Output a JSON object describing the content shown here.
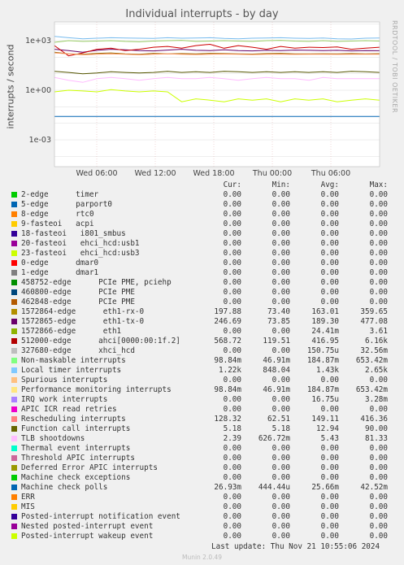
{
  "chart_data": {
    "type": "line",
    "title": "Individual interrupts - by day",
    "ylabel": "interrupts / second",
    "yscale": "log",
    "y_ticks": [
      "1e+03",
      "1e+00",
      "1e-03"
    ],
    "x_ticks": [
      "Wed 06:00",
      "Wed 12:00",
      "Wed 18:00",
      "Thu 00:00",
      "Thu 06:00"
    ],
    "grid": true,
    "series": [
      {
        "name": "Local timer interrupts",
        "color": "#77bbee",
        "values": [
          1800,
          1500,
          1300,
          1400,
          1500,
          1450,
          1400,
          1350,
          1500,
          1400,
          1450,
          1500,
          1350,
          1300,
          1400,
          1450,
          1500,
          1400,
          1350,
          1450,
          1300,
          1250,
          1400,
          1450
        ]
      },
      {
        "name": "Non-maskable interrupts",
        "color": "#99cc66",
        "values": [
          800,
          1000,
          900,
          950,
          1000,
          900,
          850,
          950,
          1000,
          1050,
          900,
          950,
          1000,
          950,
          900,
          1000,
          1050,
          950,
          900,
          1000,
          900,
          950,
          1000,
          950
        ]
      },
      {
        "name": "1572865-edge eth1-tx-0",
        "color": "#660066",
        "values": [
          300,
          250,
          200,
          260,
          300,
          280,
          250,
          240,
          270,
          300,
          260,
          250,
          280,
          250,
          240,
          260,
          250,
          270,
          260,
          250,
          260,
          240,
          250,
          245
        ]
      },
      {
        "name": "512000-edge ahci[0000:00:1f.2]",
        "color": "#cc0000",
        "values": [
          500,
          120,
          180,
          300,
          350,
          250,
          300,
          400,
          450,
          350,
          500,
          600,
          350,
          500,
          400,
          300,
          450,
          350,
          400,
          380,
          420,
          300,
          350,
          400
        ]
      },
      {
        "name": "1572864-edge eth1-rx-0",
        "color": "#996600",
        "values": [
          200,
          160,
          150,
          170,
          180,
          160,
          150,
          170,
          160,
          165,
          160,
          170,
          165,
          160,
          155,
          165,
          170,
          160,
          158,
          162,
          160,
          165,
          160,
          163
        ]
      },
      {
        "name": "Rescheduling interrupts",
        "color": "#ff9966",
        "values": [
          180,
          160,
          140,
          150,
          160,
          150,
          140,
          150,
          160,
          150,
          145,
          150,
          155,
          150,
          145,
          150,
          150,
          148,
          150,
          150,
          148,
          150,
          149,
          149
        ]
      },
      {
        "name": "Function call interrupts",
        "color": "#555500",
        "values": [
          14,
          12,
          10,
          11,
          13,
          12,
          11,
          12,
          14,
          12,
          13,
          12,
          14,
          13,
          12,
          13,
          12,
          13,
          12,
          13,
          12,
          14,
          13,
          12
        ]
      },
      {
        "name": "TLB shootdowns",
        "color": "#ffbbff",
        "values": [
          6,
          4,
          3,
          5,
          6,
          5,
          4,
          5,
          6,
          5,
          5,
          6,
          5,
          4,
          5,
          6,
          5,
          5,
          4,
          6,
          5,
          5,
          5,
          5
        ]
      },
      {
        "name": "Machine check polls",
        "color": "#0066b3",
        "values": [
          0.026,
          0.026,
          0.026,
          0.026,
          0.026,
          0.026,
          0.026,
          0.026,
          0.026,
          0.026,
          0.026,
          0.026,
          0.026,
          0.026,
          0.026,
          0.026,
          0.026,
          0.026,
          0.026,
          0.026,
          0.026,
          0.026,
          0.026,
          0.026
        ]
      },
      {
        "name": "23-fasteoi ehci_hcd:usb3",
        "color": "#ccff00",
        "values": [
          0.8,
          1.0,
          0.9,
          0.8,
          1.1,
          0.9,
          0.8,
          0.9,
          0.8,
          0.2,
          0.3,
          0.25,
          0.2,
          0.3,
          0.25,
          0.3,
          0.2,
          0.3,
          0.25,
          0.3,
          0.2,
          0.25,
          0.3,
          0.25
        ]
      }
    ]
  },
  "legend": {
    "headers": {
      "cur": "Cur:",
      "min": "Min:",
      "avg": "Avg:",
      "max": "Max:"
    },
    "rows": [
      {
        "color": "#00cc00",
        "label": "2-edge      timer",
        "cur": "0.00",
        "min": "0.00",
        "avg": "0.00",
        "max": "0.00"
      },
      {
        "color": "#0066b3",
        "label": "5-edge      parport0",
        "cur": "0.00",
        "min": "0.00",
        "avg": "0.00",
        "max": "0.00"
      },
      {
        "color": "#ff8000",
        "label": "8-edge      rtc0",
        "cur": "0.00",
        "min": "0.00",
        "avg": "0.00",
        "max": "0.00"
      },
      {
        "color": "#ffcc00",
        "label": "9-fasteoi   acpi",
        "cur": "0.00",
        "min": "0.00",
        "avg": "0.00",
        "max": "0.00"
      },
      {
        "color": "#330099",
        "label": "18-fasteoi   i801_smbus",
        "cur": "0.00",
        "min": "0.00",
        "avg": "0.00",
        "max": "0.00"
      },
      {
        "color": "#990099",
        "label": "20-fasteoi   ehci_hcd:usb1",
        "cur": "0.00",
        "min": "0.00",
        "avg": "0.00",
        "max": "0.00"
      },
      {
        "color": "#ccff00",
        "label": "23-fasteoi   ehci_hcd:usb3",
        "cur": "0.00",
        "min": "0.00",
        "avg": "0.00",
        "max": "0.00"
      },
      {
        "color": "#ff0000",
        "label": "0-edge      dmar0",
        "cur": "0.00",
        "min": "0.00",
        "avg": "0.00",
        "max": "0.00"
      },
      {
        "color": "#808080",
        "label": "1-edge      dmar1",
        "cur": "0.00",
        "min": "0.00",
        "avg": "0.00",
        "max": "0.00"
      },
      {
        "color": "#008f00",
        "label": "458752-edge      PCIe PME, pciehp",
        "cur": "0.00",
        "min": "0.00",
        "avg": "0.00",
        "max": "0.00"
      },
      {
        "color": "#00487d",
        "label": "460800-edge      PCIe PME",
        "cur": "0.00",
        "min": "0.00",
        "avg": "0.00",
        "max": "0.00"
      },
      {
        "color": "#b35a00",
        "label": "462848-edge      PCIe PME",
        "cur": "0.00",
        "min": "0.00",
        "avg": "0.00",
        "max": "0.00"
      },
      {
        "color": "#b38f00",
        "label": "1572864-edge      eth1-rx-0",
        "cur": "197.88",
        "min": "73.40",
        "avg": "163.01",
        "max": "359.65"
      },
      {
        "color": "#6b006b",
        "label": "1572865-edge      eth1-tx-0",
        "cur": "246.69",
        "min": "73.85",
        "avg": "189.30",
        "max": "477.08"
      },
      {
        "color": "#8fb300",
        "label": "1572866-edge      eth1",
        "cur": "0.00",
        "min": "0.00",
        "avg": "24.41m",
        "max": "3.61"
      },
      {
        "color": "#b30000",
        "label": "512000-edge      ahci[0000:00:1f.2]",
        "cur": "568.72",
        "min": "119.51",
        "avg": "416.95",
        "max": "6.16k"
      },
      {
        "color": "#bebebe",
        "label": "327680-edge      xhci_hcd",
        "cur": "0.00",
        "min": "0.00",
        "avg": "150.75u",
        "max": "32.56m"
      },
      {
        "color": "#80ff80",
        "label": "Non-maskable interrupts",
        "cur": "98.84m",
        "min": "46.91m",
        "avg": "184.87m",
        "max": "653.42m"
      },
      {
        "color": "#80c9ff",
        "label": "Local timer interrupts",
        "cur": "1.22k",
        "min": "848.04",
        "avg": "1.43k",
        "max": "2.65k"
      },
      {
        "color": "#ffc080",
        "label": "Spurious interrupts",
        "cur": "0.00",
        "min": "0.00",
        "avg": "0.00",
        "max": "0.00"
      },
      {
        "color": "#ffe680",
        "label": "Performance monitoring interrupts",
        "cur": "98.84m",
        "min": "46.91m",
        "avg": "184.87m",
        "max": "653.42m"
      },
      {
        "color": "#aa80ff",
        "label": "IRQ work interrupts",
        "cur": "0.00",
        "min": "0.00",
        "avg": "16.75u",
        "max": "3.28m"
      },
      {
        "color": "#ee00cc",
        "label": "APIC ICR read retries",
        "cur": "0.00",
        "min": "0.00",
        "avg": "0.00",
        "max": "0.00"
      },
      {
        "color": "#ff8080",
        "label": "Rescheduling interrupts",
        "cur": "128.32",
        "min": "62.51",
        "avg": "149.11",
        "max": "416.36"
      },
      {
        "color": "#666600",
        "label": "Function call interrupts",
        "cur": "5.18",
        "min": "5.18",
        "avg": "12.94",
        "max": "90.00"
      },
      {
        "color": "#ffbfff",
        "label": "TLB shootdowns",
        "cur": "2.39",
        "min": "626.72m",
        "avg": "5.43",
        "max": "81.33"
      },
      {
        "color": "#00ffcc",
        "label": "Thermal event interrupts",
        "cur": "0.00",
        "min": "0.00",
        "avg": "0.00",
        "max": "0.00"
      },
      {
        "color": "#cc6699",
        "label": "Threshold APIC interrupts",
        "cur": "0.00",
        "min": "0.00",
        "avg": "0.00",
        "max": "0.00"
      },
      {
        "color": "#999900",
        "label": "Deferred Error APIC interrupts",
        "cur": "0.00",
        "min": "0.00",
        "avg": "0.00",
        "max": "0.00"
      },
      {
        "color": "#00cc00",
        "label": "Machine check exceptions",
        "cur": "0.00",
        "min": "0.00",
        "avg": "0.00",
        "max": "0.00"
      },
      {
        "color": "#0066b3",
        "label": "Machine check polls",
        "cur": "26.93m",
        "min": "444.44u",
        "avg": "25.66m",
        "max": "42.52m"
      },
      {
        "color": "#ff8000",
        "label": "ERR",
        "cur": "0.00",
        "min": "0.00",
        "avg": "0.00",
        "max": "0.00"
      },
      {
        "color": "#ffcc00",
        "label": "MIS",
        "cur": "0.00",
        "min": "0.00",
        "avg": "0.00",
        "max": "0.00"
      },
      {
        "color": "#330099",
        "label": "Posted-interrupt notification event",
        "cur": "0.00",
        "min": "0.00",
        "avg": "0.00",
        "max": "0.00"
      },
      {
        "color": "#990099",
        "label": "Nested posted-interrupt event",
        "cur": "0.00",
        "min": "0.00",
        "avg": "0.00",
        "max": "0.00"
      },
      {
        "color": "#ccff00",
        "label": "Posted-interrupt wakeup event",
        "cur": "0.00",
        "min": "0.00",
        "avg": "0.00",
        "max": "0.00"
      }
    ]
  },
  "footer": {
    "last_update": "Last update: Thu Nov 21 10:55:06 2024",
    "munin": "Munin 2.0.49",
    "watermark": "RRDTOOL / TOBI OETIKER"
  }
}
